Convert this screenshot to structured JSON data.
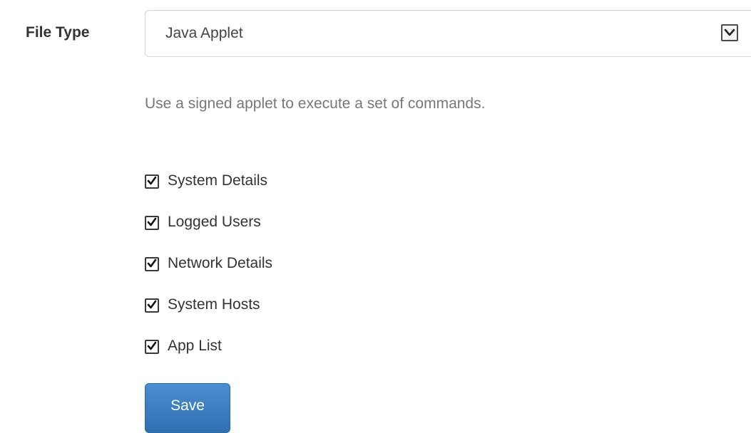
{
  "form": {
    "file_type_label": "File Type",
    "file_type_select": {
      "selected": "Java Applet",
      "arrow_icon": "chevron-down-icon"
    },
    "help_text": "Use a signed applet to execute a set of commands.",
    "options": [
      {
        "label": "System Details",
        "checked": true
      },
      {
        "label": "Logged Users",
        "checked": true
      },
      {
        "label": "Network Details",
        "checked": true
      },
      {
        "label": "System Hosts",
        "checked": true
      },
      {
        "label": "App List",
        "checked": true
      }
    ],
    "save_label": "Save"
  },
  "colors": {
    "primary_button": "#337ab7",
    "help_text": "#777777"
  }
}
